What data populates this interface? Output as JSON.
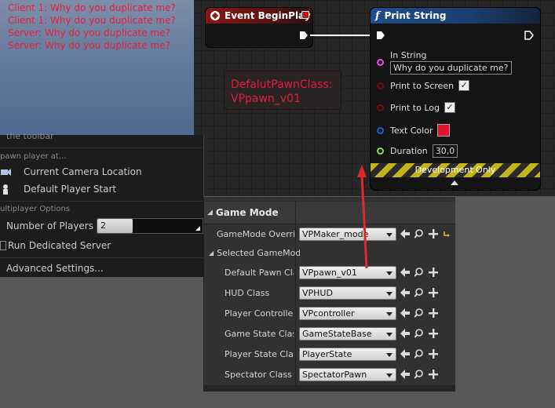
{
  "viewport": {
    "messages": [
      "Client 1: Why do you duplicate me?",
      "Client 1: Why do you duplicate me?",
      "Server: Why do you duplicate me?",
      "Server: Why do you duplicate me?"
    ]
  },
  "event_node": {
    "title": "Event BeginPlay"
  },
  "print_node": {
    "title": "Print String",
    "in_string_label": "In String",
    "in_string_value": "Why do you duplicate me?",
    "print_to_screen_label": "Print to Screen",
    "print_to_log_label": "Print to Log",
    "text_color_label": "Text Color",
    "text_color": "#e8112d",
    "duration_label": "Duration",
    "duration_value": "30,0",
    "dev_only_label": "Development Only"
  },
  "comment": {
    "text": "DefalutPawnClass:\nVPpawn_v01"
  },
  "play_menu": {
    "toolbar_text": "the toolbar",
    "spawn_section": "pawn player at...",
    "camera_location": "Current Camera Location",
    "default_player_start": "Default Player Start",
    "multiplayer_section": "ultiplayer Options",
    "num_players_label": "Number of Players",
    "num_players_value": "2",
    "dedicated_server": "Run Dedicated Server",
    "advanced_settings": "Advanced Settings..."
  },
  "game_mode": {
    "header": "Game Mode",
    "override_label": "GameMode Override",
    "override_value": "VPMaker_mode",
    "selected_label": "Selected GameMode",
    "rows": [
      {
        "label": "Default Pawn Class",
        "value": "VPpawn_v01"
      },
      {
        "label": "HUD Class",
        "value": "VPHUD"
      },
      {
        "label": "Player Controller Class",
        "value": "VPcontroller"
      },
      {
        "label": "Game State Class",
        "value": "GameStateBase"
      },
      {
        "label": "Player State Class",
        "value": "PlayerState"
      },
      {
        "label": "Spectator Class",
        "value": "SpectatorPawn"
      }
    ]
  }
}
